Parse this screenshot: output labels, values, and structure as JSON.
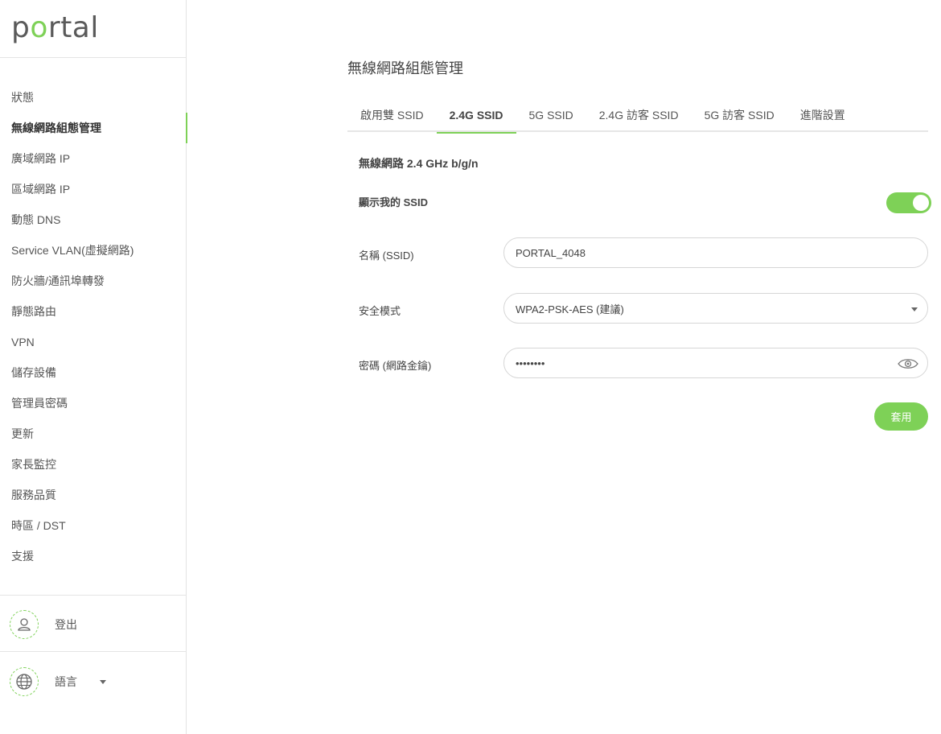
{
  "brand": {
    "logo_p": "p",
    "logo_o": "o",
    "logo_rest": "rtal",
    "accent": "#7ed157"
  },
  "sidebar": {
    "items": [
      {
        "label": "狀態"
      },
      {
        "label": "無線網路組態管理",
        "active": true
      },
      {
        "label": "廣域網路 IP"
      },
      {
        "label": "區域網路 IP"
      },
      {
        "label": "動態 DNS"
      },
      {
        "label": "Service VLAN(虛擬網路)"
      },
      {
        "label": "防火牆/通訊埠轉發"
      },
      {
        "label": "靜態路由"
      },
      {
        "label": "VPN"
      },
      {
        "label": "儲存設備"
      },
      {
        "label": "管理員密碼"
      },
      {
        "label": "更新"
      },
      {
        "label": "家長監控"
      },
      {
        "label": "服務品質"
      },
      {
        "label": "時區 / DST"
      },
      {
        "label": "支援"
      }
    ],
    "logout": {
      "label": "登出",
      "icon": "user-icon"
    },
    "language": {
      "label": "語言",
      "icon": "globe-icon"
    }
  },
  "main": {
    "title": "無線網路組態管理",
    "tabs": [
      {
        "label": "啟用雙 SSID"
      },
      {
        "label": "2.4G SSID",
        "active": true
      },
      {
        "label": "5G SSID"
      },
      {
        "label": "2.4G 訪客 SSID"
      },
      {
        "label": "5G 訪客 SSID"
      },
      {
        "label": "進階設置"
      }
    ],
    "section_title": "無線網路 2.4 GHz b/g/n",
    "show_ssid": {
      "label": "顯示我的 SSID",
      "enabled": true
    },
    "ssid_name": {
      "label": "名稱 (SSID)",
      "value": "PORTAL_4048"
    },
    "security": {
      "label": "安全模式",
      "value": "WPA2-PSK-AES (建議)"
    },
    "password": {
      "label": "密碼 (網路金鑰)",
      "value": "password"
    },
    "apply_label": "套用"
  }
}
